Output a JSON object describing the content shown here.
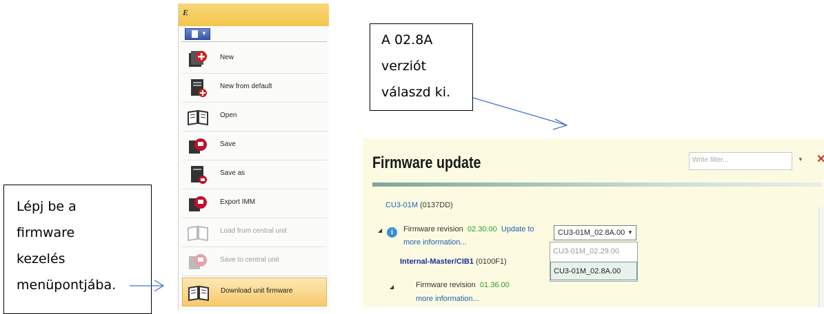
{
  "callouts": {
    "left": [
      "Lépj be a",
      "firmware",
      "kezelés",
      "menüpontjába."
    ],
    "right": [
      "A 02.8A",
      "verziót",
      "válaszd ki."
    ]
  },
  "menu": {
    "title_glyph": "E",
    "items": [
      {
        "label": "New",
        "icon": "new-icon",
        "state": "normal"
      },
      {
        "label": "New from default",
        "icon": "new-from-default-icon",
        "state": "normal"
      },
      {
        "label": "Open",
        "icon": "open-book-icon",
        "state": "normal"
      },
      {
        "label": "Save",
        "icon": "save-icon",
        "state": "normal"
      },
      {
        "label": "Save as",
        "icon": "save-as-icon",
        "state": "normal"
      },
      {
        "label": "Export IMM",
        "icon": "export-icon",
        "state": "normal"
      },
      {
        "label": "Load from central unit",
        "icon": "load-book-icon",
        "state": "disabled"
      },
      {
        "label": "Save to central unit",
        "icon": "save-central-icon",
        "state": "disabled"
      },
      {
        "label": "Download unit firmware",
        "icon": "download-book-icon",
        "state": "selected"
      }
    ]
  },
  "firmware": {
    "title": "Firmware update",
    "filter_placeholder": "Write filter...",
    "unit1": {
      "name": "CU3-01M",
      "id": "(0137DD)"
    },
    "rev1": {
      "label": "Firmware revision",
      "value": "02.30.00",
      "update_label": "Update to",
      "more": "more information..."
    },
    "selected_version": "CU3-01M_02.8A.00",
    "options": [
      "CU3-01M_02.29.00",
      "CU3-01M_02.8A.00"
    ],
    "unit2": {
      "name": "Internal-Master/CIB1",
      "id": "(0100F1)"
    },
    "rev2": {
      "label": "Firmware revision",
      "value": "01.36.00",
      "more": "more information..."
    }
  },
  "colors": {
    "accent": "#f3c54b",
    "link": "#1f5fb0",
    "value_green": "#2b9a2b",
    "panel_bg": "#fcfbe1",
    "arrow": "#4472c4"
  }
}
